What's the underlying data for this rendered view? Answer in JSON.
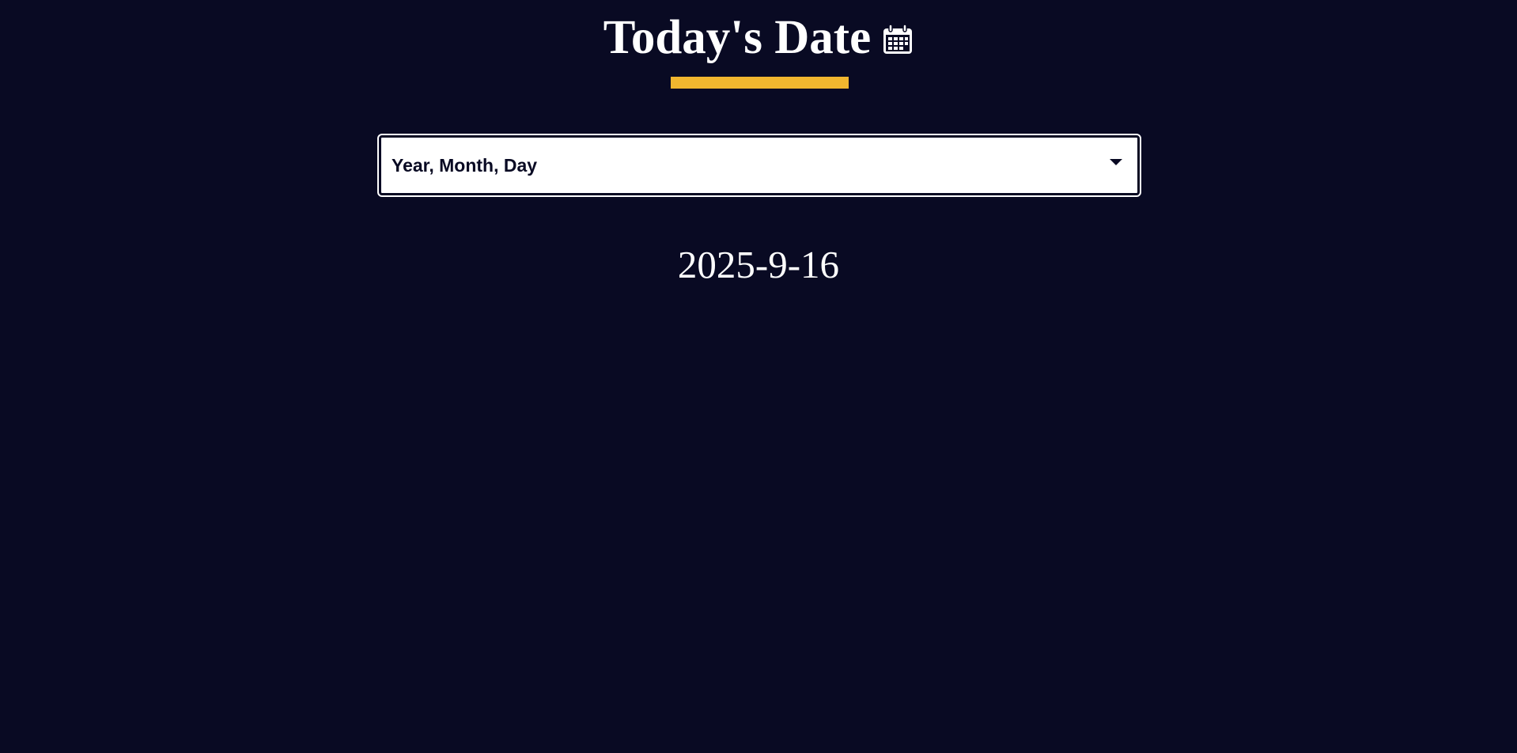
{
  "header": {
    "title": "Today's Date",
    "icon": "calendar-icon",
    "accent_color": "#f1b62f"
  },
  "format_select": {
    "selected": "Year, Month, Day"
  },
  "date_display": {
    "value": "2025-9-16"
  },
  "colors": {
    "background": "#090a23",
    "text": "#ffffff",
    "accent": "#f1b62f"
  }
}
